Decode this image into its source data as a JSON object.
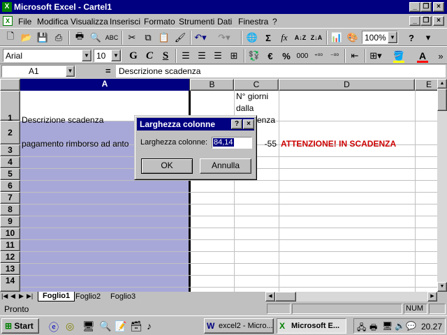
{
  "window": {
    "title": "Microsoft Excel - Cartel1"
  },
  "menus": [
    "File",
    "Modifica",
    "Visualizza",
    "Inserisci",
    "Formato",
    "Strumenti",
    "Dati",
    "Finestra",
    "?"
  ],
  "standard_toolbar": {
    "zoom": "100%",
    "help_glyph": "?"
  },
  "format_toolbar": {
    "font": "Arial",
    "size": "10",
    "bold": "G",
    "italic": "C",
    "underline": "S",
    "currency": "€",
    "percent": "%",
    "thousands": "000"
  },
  "formula_bar": {
    "name_box": "A1",
    "equals": "=",
    "content": "Descrizione scadenza"
  },
  "columns": [
    "A",
    "B",
    "C",
    "D",
    "E"
  ],
  "rows": [
    "1",
    "2",
    "3",
    "4",
    "5",
    "6",
    "7",
    "8",
    "9",
    "10",
    "11",
    "12",
    "13",
    "14"
  ],
  "cells": {
    "A1": "Descrizione scadenza",
    "C1_line1": "N° giorni",
    "C1_line2": "dalla",
    "C1_line3": "enza",
    "A2": "pagamento rimborso ad anto",
    "C2": "-55",
    "D2": "ATTENZIONE! IN SCADENZA"
  },
  "sheets": [
    "Foglio1",
    "Foglio2",
    "Foglio3"
  ],
  "status": {
    "left": "Pronto",
    "num": "NUM"
  },
  "dialog": {
    "title": "Larghezza colonne",
    "help": "?",
    "label": "Larghezza colonne:",
    "value": "84,14",
    "ok": "OK",
    "cancel": "Annulla"
  },
  "taskbar": {
    "start": "Start",
    "task1": "excel2 - Micro...",
    "task2": "Microsoft E...",
    "clock": "20.27"
  },
  "colors": {
    "title_bg": "#000080",
    "selection": "#a8a8d8",
    "warning": "#cc0000"
  }
}
